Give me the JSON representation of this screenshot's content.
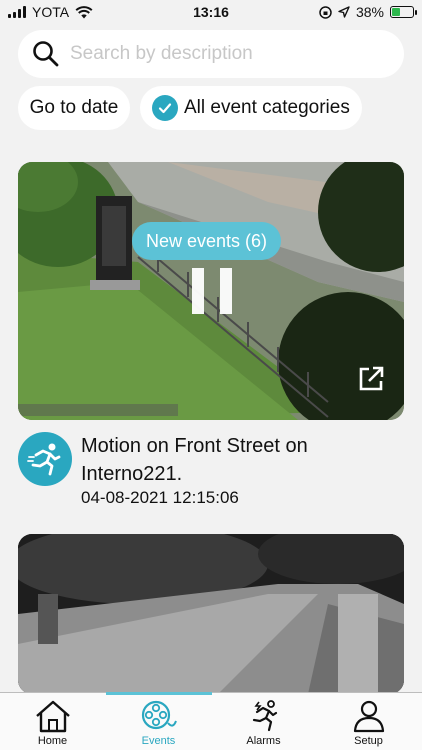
{
  "status_bar": {
    "carrier": "YOTA",
    "time": "13:16",
    "battery": "38%",
    "battery_level": 0.38
  },
  "search": {
    "placeholder": "Search by description"
  },
  "filters": {
    "date_label": "Go to date",
    "categories_label": "All event categories",
    "categories_checked": true
  },
  "event": {
    "new_events_label": "New events (6)",
    "title": "Motion on Front Street on Interno221.",
    "timestamp": "04-08-2021 12:15:06",
    "icon": "running-person-icon"
  },
  "tabbar": {
    "active": "events",
    "tabs": [
      {
        "id": "home",
        "label": "Home",
        "icon": "home-icon"
      },
      {
        "id": "events",
        "label": "Events",
        "icon": "film-reel-icon"
      },
      {
        "id": "alarms",
        "label": "Alarms",
        "icon": "running-alarm-icon"
      },
      {
        "id": "setup",
        "label": "Setup",
        "icon": "person-icon"
      }
    ]
  },
  "colors": {
    "accent": "#2aa7c0",
    "accent_light": "#5cc2d6",
    "background": "#f2f2f2"
  }
}
